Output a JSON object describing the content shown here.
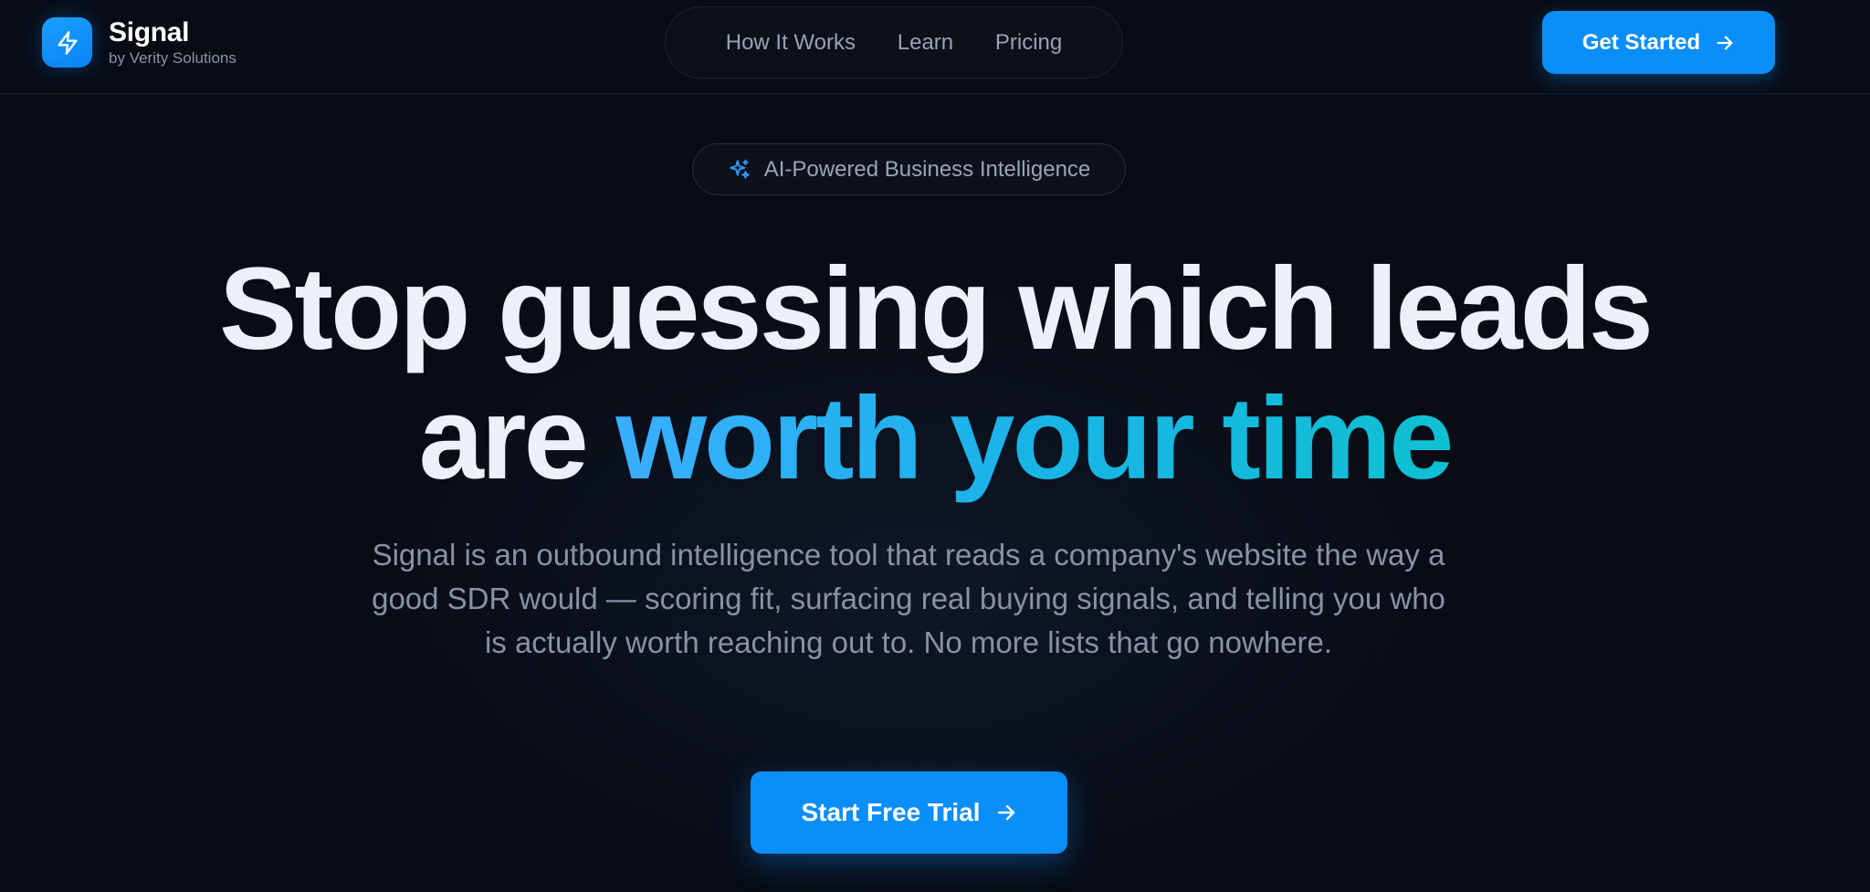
{
  "brand": {
    "name": "Signal",
    "subtitle": "by Verity Solutions",
    "logo_icon": "lightning-bolt-icon",
    "accent_color": "#0a8ef9"
  },
  "nav": {
    "items": [
      {
        "label": "How It Works"
      },
      {
        "label": "Learn"
      },
      {
        "label": "Pricing"
      }
    ]
  },
  "header_cta": {
    "label": "Get Started",
    "icon": "arrow-right-icon"
  },
  "hero": {
    "badge": {
      "label": "AI-Powered Business Intelligence",
      "icon": "sparkles-icon"
    },
    "headline_line1": "Stop guessing which leads",
    "headline_line2_plain": "are ",
    "headline_line2_highlight": "worth your time",
    "description": "Signal is an outbound intelligence tool that reads a company's website the way a good SDR would — scoring fit, surfacing real buying signals, and telling you who is actually worth reaching out to. No more lists that go nowhere.",
    "cta": {
      "label": "Start Free Trial",
      "icon": "arrow-right-icon"
    }
  },
  "colors": {
    "background": "#070b14",
    "gradient_start": "#3aaeff",
    "gradient_end": "#0fc0d2",
    "muted_text": "#8a91a5"
  }
}
